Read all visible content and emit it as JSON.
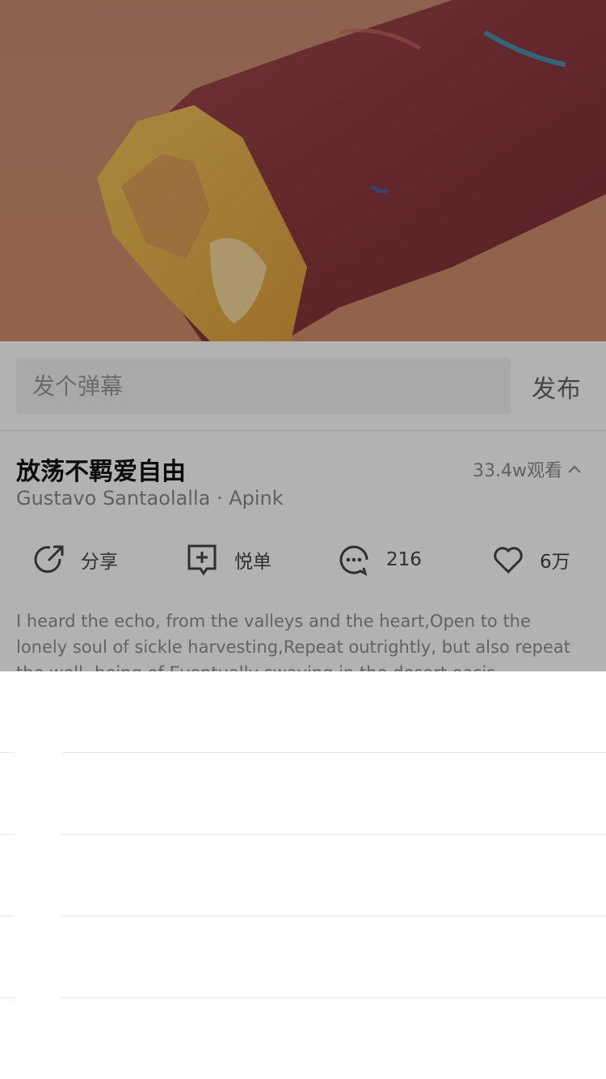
{
  "danmaku": {
    "placeholder": "发个弹幕",
    "publish_label": "发布"
  },
  "song": {
    "title": "放荡不羁爱自由",
    "views": "33.4w观看",
    "artists": "Gustavo Santaolalla · Apink"
  },
  "actions": [
    {
      "icon": "share-icon",
      "label": "分享"
    },
    {
      "icon": "add-playlist-icon",
      "label": "悦单"
    },
    {
      "icon": "comment-icon",
      "label": "216"
    },
    {
      "icon": "heart-icon",
      "label": "6万"
    }
  ],
  "description": "I heard the echo, from the valleys and the heart,Open to the lonely soul of sickle harvesting,Repeat outrightly, but also repeat the well- being of Eventually swaying in the desert oasis",
  "colors": {
    "overlay": "#000000",
    "text_primary": "#111111",
    "text_secondary": "#8a8a8a"
  }
}
